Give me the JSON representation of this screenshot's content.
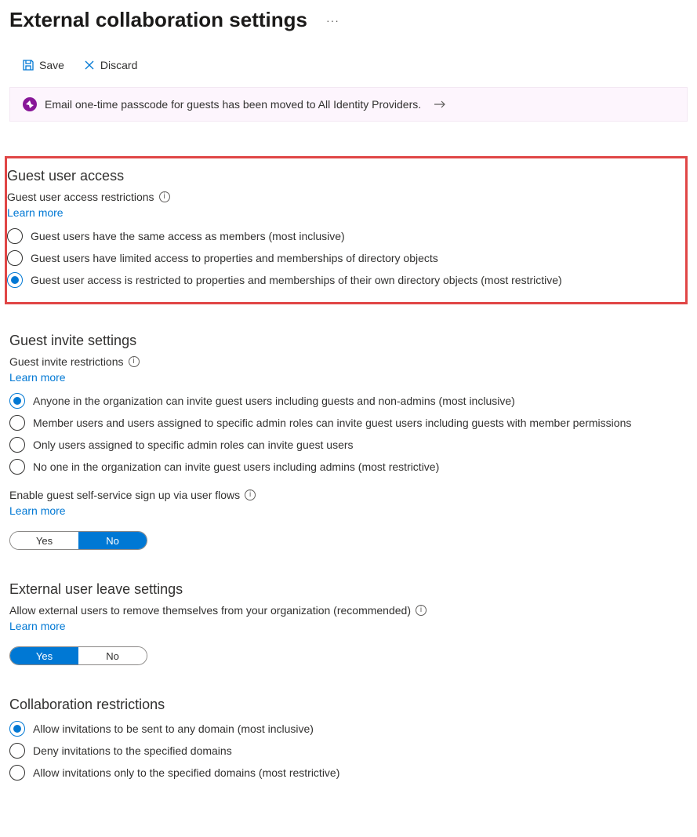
{
  "header": {
    "title": "External collaboration settings",
    "more": "···"
  },
  "toolbar": {
    "save": "Save",
    "discard": "Discard"
  },
  "banner": {
    "text": "Email one-time passcode for guests has been moved to All Identity Providers."
  },
  "sections": {
    "guestAccess": {
      "title": "Guest user access",
      "fieldLabel": "Guest user access restrictions",
      "learnMore": "Learn more",
      "options": [
        "Guest users have the same access as members (most inclusive)",
        "Guest users have limited access to properties and memberships of directory objects",
        "Guest user access is restricted to properties and memberships of their own directory objects (most restrictive)"
      ],
      "selectedIndex": 2
    },
    "guestInvite": {
      "title": "Guest invite settings",
      "fieldLabel": "Guest invite restrictions",
      "learnMore": "Learn more",
      "options": [
        "Anyone in the organization can invite guest users including guests and non-admins (most inclusive)",
        "Member users and users assigned to specific admin roles can invite guest users including guests with member permissions",
        "Only users assigned to specific admin roles can invite guest users",
        "No one in the organization can invite guest users including admins (most restrictive)"
      ],
      "selectedIndex": 0,
      "selfService": {
        "label": "Enable guest self-service sign up via user flows",
        "learnMore": "Learn more",
        "yes": "Yes",
        "no": "No",
        "value": "No"
      }
    },
    "externalLeave": {
      "title": "External user leave settings",
      "fieldLabel": "Allow external users to remove themselves from your organization (recommended)",
      "learnMore": "Learn more",
      "yes": "Yes",
      "no": "No",
      "value": "Yes"
    },
    "collabRestrictions": {
      "title": "Collaboration restrictions",
      "options": [
        "Allow invitations to be sent to any domain (most inclusive)",
        "Deny invitations to the specified domains",
        "Allow invitations only to the specified domains (most restrictive)"
      ],
      "selectedIndex": 0
    }
  }
}
